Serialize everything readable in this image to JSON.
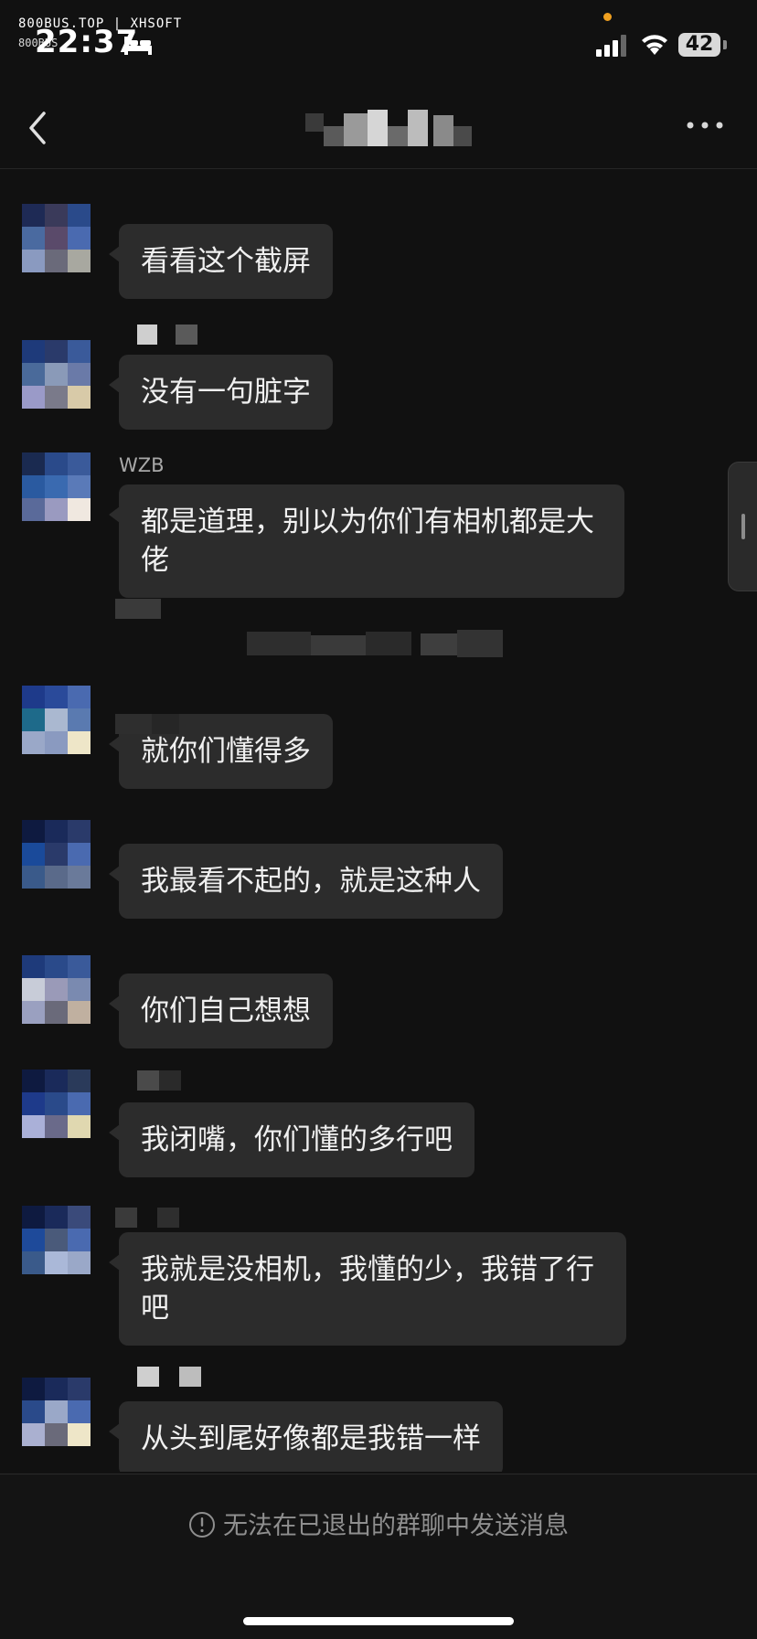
{
  "status_bar": {
    "watermark": "800BUS.TOP | XHSOFT",
    "watermark_small": "800BUS",
    "time": "22:37",
    "battery": "42",
    "icons": [
      "bed-icon",
      "signal-icon",
      "wifi-icon",
      "battery-icon"
    ]
  },
  "nav": {
    "icons": [
      "back-icon",
      "more-icon"
    ]
  },
  "messages": [
    {
      "sender": "",
      "text": "看看这个截屏"
    },
    {
      "sender": "",
      "text": "没有一句脏字"
    },
    {
      "sender": "WZB",
      "text": "都是道理，别以为你们有相机都是大佬"
    },
    {
      "sender": "",
      "text": "就你们懂得多"
    },
    {
      "sender": "",
      "text": "我最看不起的，就是这种人"
    },
    {
      "sender": "",
      "text": "你们自己想想"
    },
    {
      "sender": "",
      "text": "我闭嘴，你们懂的多行吧"
    },
    {
      "sender": "",
      "text": "我就是没相机，我懂的少，我错了行吧"
    },
    {
      "sender": "",
      "text": "从头到尾好像都是我错一样"
    }
  ],
  "footer": {
    "notice": "无法在已退出的群聊中发送消息",
    "icon": "exclamation-circle-icon"
  },
  "colors": {
    "background": "#111111",
    "bubble": "#2c2c2c",
    "text": "#f0f0f0",
    "muted": "#8f8f8f"
  }
}
